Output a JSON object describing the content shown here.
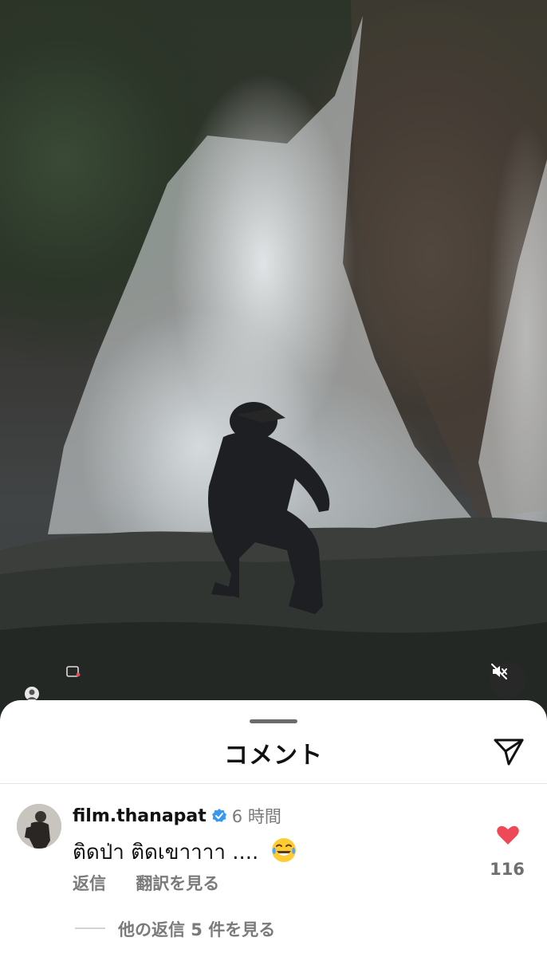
{
  "post": {
    "photo_description_icon": "waterfall-photo",
    "mute_icon": "speaker-muted-icon"
  },
  "comments_sheet": {
    "title": "コメント",
    "share_icon": "paper-plane-icon"
  },
  "comment": {
    "username": "film.thanapat",
    "verified": true,
    "time": "6 時間",
    "text": "ติดป่า ติดเขาาาา ....",
    "emoji": "face-with-tears-of-joy",
    "reply_label": "返信",
    "translate_label": "翻訳を見る",
    "like_count": "116",
    "view_replies_label": "他の返信 5 件を見る"
  },
  "colors": {
    "like_red": "#ed4956",
    "verified_blue": "#3897f0"
  }
}
